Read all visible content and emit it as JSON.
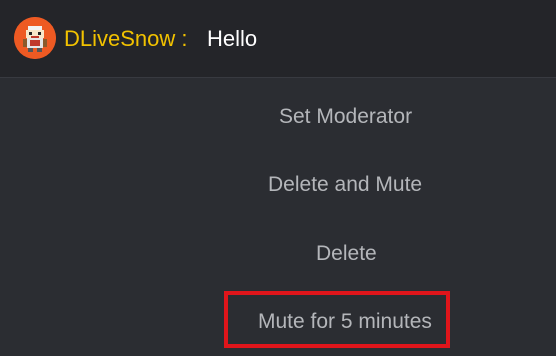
{
  "chat_message": {
    "avatar_icon": "streamer-avatar-icon",
    "username": "DLiveSnow :",
    "text": "Hello",
    "username_color": "#f2c200",
    "avatar_color": "#ee5a23"
  },
  "context_menu": {
    "items": [
      {
        "label": "Set Moderator"
      },
      {
        "label": "Delete and Mute"
      },
      {
        "label": "Delete"
      },
      {
        "label": "Mute for 5 minutes"
      }
    ],
    "highlight_color": "#e0151b"
  }
}
